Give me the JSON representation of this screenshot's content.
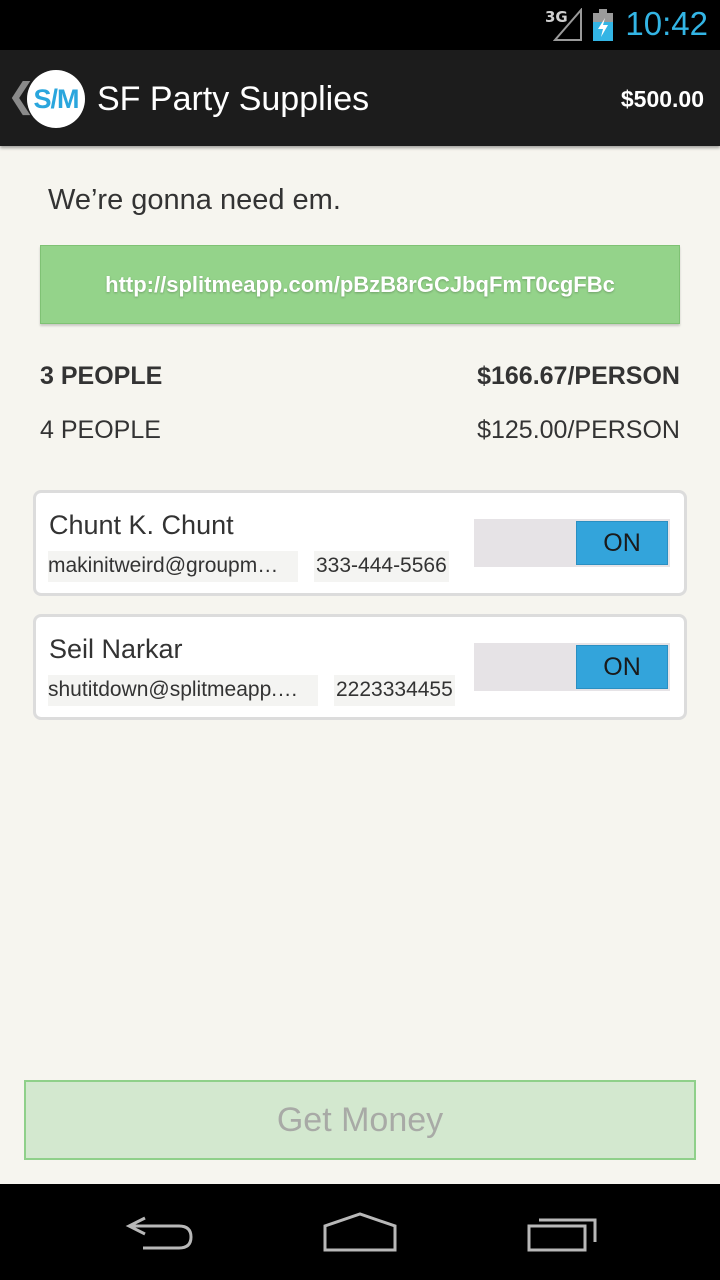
{
  "status_bar": {
    "network": "3G",
    "time": "10:42",
    "icons": [
      "signal-icon",
      "battery-charging-icon"
    ]
  },
  "action_bar": {
    "logo_text": "S/M",
    "title": "SF Party Supplies",
    "total": "$500.00"
  },
  "description": "We’re gonna need em.",
  "share_link": "http://splitmeapp.com/pBzB8rGCJbqFmT0cgFBc",
  "splits": [
    {
      "people": "3 PEOPLE",
      "amount": "$166.67/PERSON",
      "selected": true
    },
    {
      "people": "4 PEOPLE",
      "amount": "$125.00/PERSON",
      "selected": false
    }
  ],
  "contacts": [
    {
      "name": "Chunt K. Chunt",
      "email": "makinitweird@groupm…",
      "phone": "333-444-5566",
      "toggle": "ON"
    },
    {
      "name": "Seil Narkar",
      "email": "shutitdown@splitmeapp.…",
      "phone": "2223334455",
      "toggle": "ON"
    }
  ],
  "primary_button": "Get Money",
  "nav_bar": {
    "icons": [
      "back-icon",
      "home-icon",
      "recent-apps-icon"
    ]
  },
  "colors": {
    "accent_blue": "#33b5e5",
    "link_green": "#94d38a",
    "toggle_on": "#33a4db"
  }
}
